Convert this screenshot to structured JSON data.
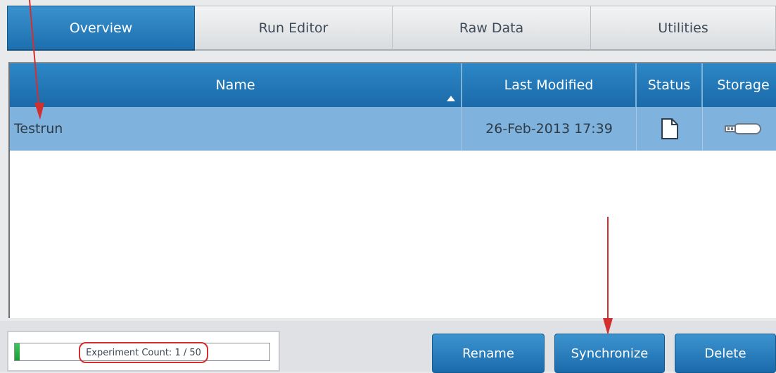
{
  "tabs": [
    {
      "label": "Overview",
      "active": true
    },
    {
      "label": "Run Editor",
      "active": false
    },
    {
      "label": "Raw Data",
      "active": false
    },
    {
      "label": "Utilities",
      "active": false
    }
  ],
  "table": {
    "columns": [
      "Name",
      "Last Modified",
      "Status",
      "Storage"
    ],
    "sort": {
      "column": "Name",
      "direction": "ascending"
    },
    "rows": [
      {
        "name": "Testrun",
        "last_modified": "26-Feb-2013 17:39",
        "status_icon": "document-icon",
        "storage_icon": "usb-storage-icon",
        "selected": true
      }
    ]
  },
  "footer": {
    "experiment_count_label": "Experiment Count: 1 / 50",
    "experiment_count": {
      "current": 1,
      "max": 50
    },
    "buttons": {
      "rename": "Rename",
      "synchronize": "Synchronize",
      "delete": "Delete"
    }
  },
  "colors": {
    "accent_blue": "#1d6fae",
    "selected_row": "#7fb2dc",
    "progress_green": "#2fb34b",
    "annotation_red": "#d23030"
  }
}
